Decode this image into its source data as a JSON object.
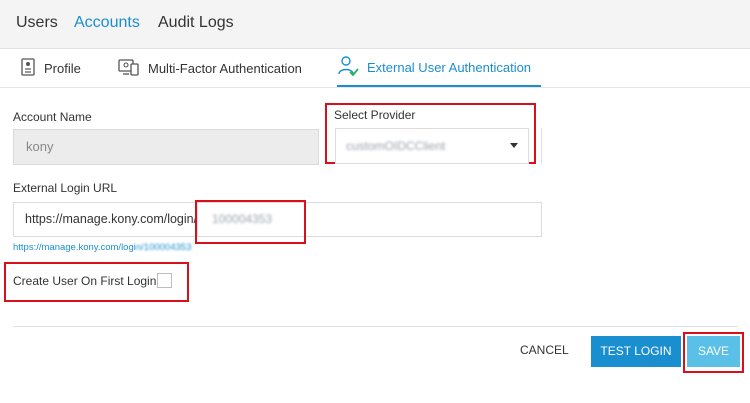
{
  "top_tabs": [
    "Users",
    "Accounts",
    "Audit Logs"
  ],
  "sub_tabs": [
    "Profile",
    "Multi-Factor Authentication",
    "External User Authentication"
  ],
  "form": {
    "account_name_label": "Account Name",
    "account_name_value": "kony",
    "provider_label": "Select Provider",
    "provider_value": "customOIDCClient",
    "login_url_label": "External Login URL",
    "login_url_prefix": "https://manage.kony.com/login/",
    "login_url_value": "100004353",
    "login_url_preview_prefix": "https://manage.kony.com/logi",
    "login_url_preview_suffix": "n/100004353",
    "create_user_label": "Create User On First Login"
  },
  "actions": {
    "cancel": "CANCEL",
    "test_login": "TEST LOGIN",
    "save": "SAVE"
  },
  "colors": {
    "accent": "#1a8fcf",
    "save_button": "#5bc0e8",
    "highlight": "#d8101b"
  }
}
